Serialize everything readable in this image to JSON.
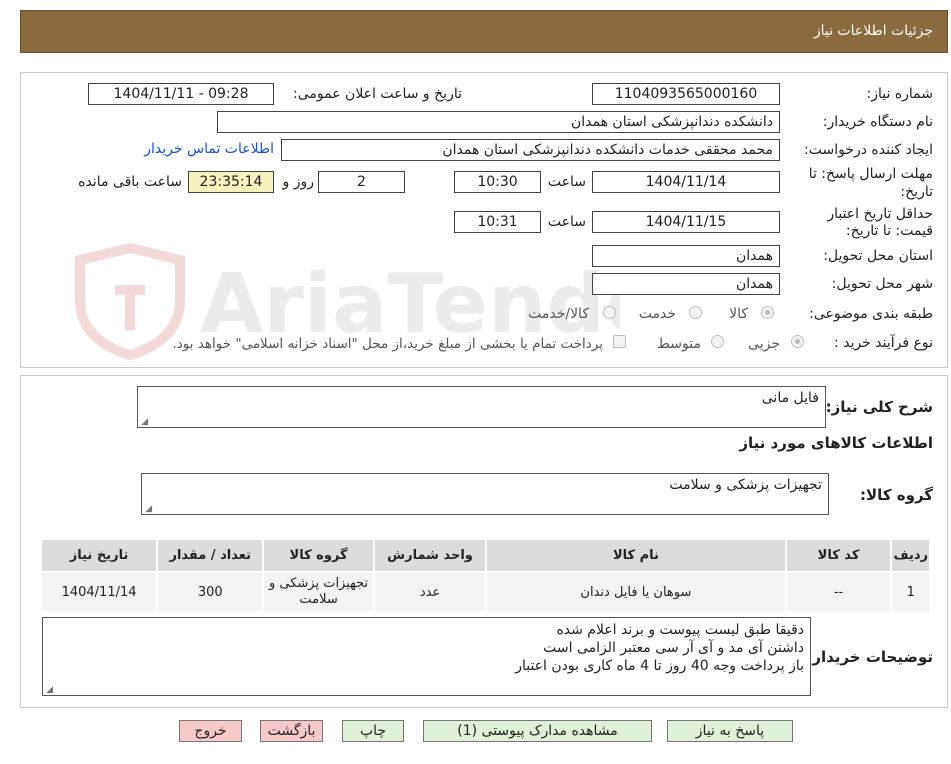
{
  "header": {
    "title": "جزئیات اطلاعات نیاز"
  },
  "form": {
    "need_number_label": "شماره نیاز:",
    "need_number": "1104093565000160",
    "announce_label": "تاریخ و ساعت اعلان عمومی:",
    "announce_value": "1404/11/11 - 09:28",
    "buyer_org_label": "نام دستگاه خریدار:",
    "buyer_org": "دانشکده دندانپزشکی استان همدان",
    "requester_label": "ایجاد کننده درخواست:",
    "requester": "محمد محققی خدمات دانشکده دندانپزشکی استان همدان",
    "contact_link": "اطلاعات تماس خریدار",
    "deadline_label_1": "مهلت ارسال پاسخ: تا",
    "deadline_label_2": "تاریخ:",
    "deadline_date": "1404/11/14",
    "time_label": "ساعت",
    "deadline_time": "10:30",
    "days_value": "2",
    "days_label": "روز و",
    "remaining_time": "23:35:14",
    "remaining_label": "ساعت باقی مانده",
    "validity_label_1": "حداقل تاریخ اعتبار",
    "validity_label_2": "قیمت: تا تاریخ:",
    "validity_date": "1404/11/15",
    "validity_time_label": "ساعت",
    "validity_time": "10:31",
    "province_label": "استان محل تحویل:",
    "province": "همدان",
    "city_label": "شهر محل تحویل:",
    "city": "همدان",
    "category_label": "طبقه بندی موضوعی:",
    "category_options": [
      "کالا",
      "خدمت",
      "کالا/خدمت"
    ],
    "process_label": "نوع فرآیند خرید :",
    "process_options": [
      "جزیی",
      "متوسط"
    ],
    "treasury_note": "پرداخت تمام یا بخشی از مبلغ خرید،از محل \"اسناد خزانه اسلامی\" خواهد بود."
  },
  "watermark": {
    "text": "AriaTender.neT"
  },
  "details": {
    "description_label": "شرح کلی نیاز:",
    "description": "فایل مانی",
    "items_title": "اطلاعات کالاهای مورد نیاز",
    "group_label": "گروه کالا:",
    "group_value": "تجهیزات پزشکی و سلامت"
  },
  "table": {
    "headers": [
      "ردیف",
      "کد کالا",
      "نام کالا",
      "واحد شمارش",
      "گروه کالا",
      "تعداد / مقدار",
      "تاریخ نیاز"
    ],
    "rows": [
      [
        "1",
        "--",
        "سوهان یا فایل دندان",
        "عدد",
        "تجهیزات پزشکی و سلامت",
        "300",
        "1404/11/14"
      ]
    ]
  },
  "notes": {
    "label": "توضیحات خریدار:",
    "lines": [
      "دقیقا طبق لیست پیوست و برند اعلام شده",
      "داشتن آی مد و آی آر سی معتبر الزامی است",
      "باز پرداخت وجه 40 روز تا 4 ماه کاری بودن اعتبار"
    ]
  },
  "buttons": {
    "reply": "پاسخ به نیاز",
    "attachments": "مشاهده مدارک پیوستی (1)",
    "print": "چاپ",
    "back": "بازگشت",
    "exit": "خروج"
  },
  "colors": {
    "header_bg": "#8b6a3e",
    "link": "#1a4fd6",
    "yellow_box": "#f6f2bd",
    "green_btn": "#dff1d8",
    "pink_btn": "#f7c9c9"
  }
}
